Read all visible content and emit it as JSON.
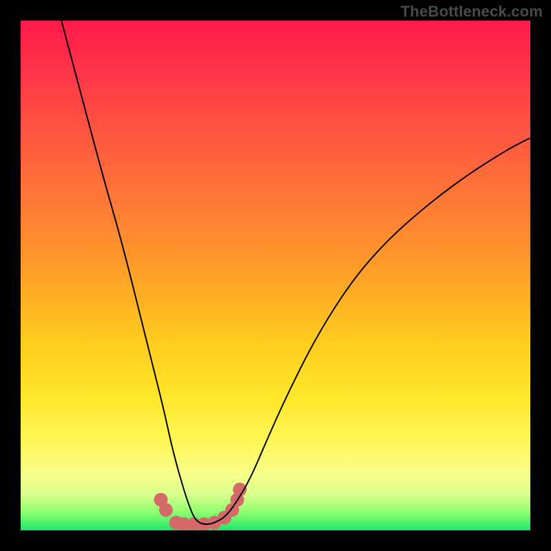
{
  "watermark": "TheBottleneck.com",
  "chart_data": {
    "type": "line",
    "title": "",
    "xlabel": "",
    "ylabel": "",
    "xlim": [
      0,
      100
    ],
    "ylim": [
      0,
      100
    ],
    "gradient_stops": [
      {
        "pct": 0,
        "color": "#ff1a4b"
      },
      {
        "pct": 8,
        "color": "#ff2f4a"
      },
      {
        "pct": 22,
        "color": "#ff5640"
      },
      {
        "pct": 36,
        "color": "#ff7a36"
      },
      {
        "pct": 50,
        "color": "#ffa127"
      },
      {
        "pct": 63,
        "color": "#ffcc1e"
      },
      {
        "pct": 74,
        "color": "#ffe72a"
      },
      {
        "pct": 83,
        "color": "#fff85a"
      },
      {
        "pct": 89,
        "color": "#f7ff8a"
      },
      {
        "pct": 93,
        "color": "#d9ff8c"
      },
      {
        "pct": 96.5,
        "color": "#8cff6e"
      },
      {
        "pct": 100,
        "color": "#1ee86a"
      }
    ],
    "series": [
      {
        "name": "bottleneck-curve",
        "color": "#000000",
        "width": 2,
        "x": [
          8,
          12,
          16,
          20,
          24,
          26,
          28,
          30,
          32,
          33,
          34,
          35,
          36,
          37,
          38,
          40,
          42,
          45,
          48,
          52,
          58,
          65,
          72,
          80,
          88,
          96,
          100
        ],
        "y": [
          100,
          85,
          70,
          56,
          40,
          32,
          24,
          15,
          8,
          5,
          2.5,
          1.5,
          1.2,
          1.2,
          1.5,
          2.5,
          5,
          10,
          17,
          26,
          38,
          49,
          57,
          64,
          70,
          75,
          77
        ]
      }
    ],
    "markers": {
      "name": "highlight-dots",
      "color": "#d46a6a",
      "radius": 10,
      "x": [
        27.5,
        28.5,
        30.5,
        32.0,
        34.0,
        36.0,
        38.0,
        40.0,
        41.5,
        42.5,
        43.0
      ],
      "y": [
        6.0,
        4.0,
        1.5,
        1.2,
        1.2,
        1.2,
        1.5,
        2.5,
        4.0,
        6.0,
        8.0
      ]
    }
  }
}
